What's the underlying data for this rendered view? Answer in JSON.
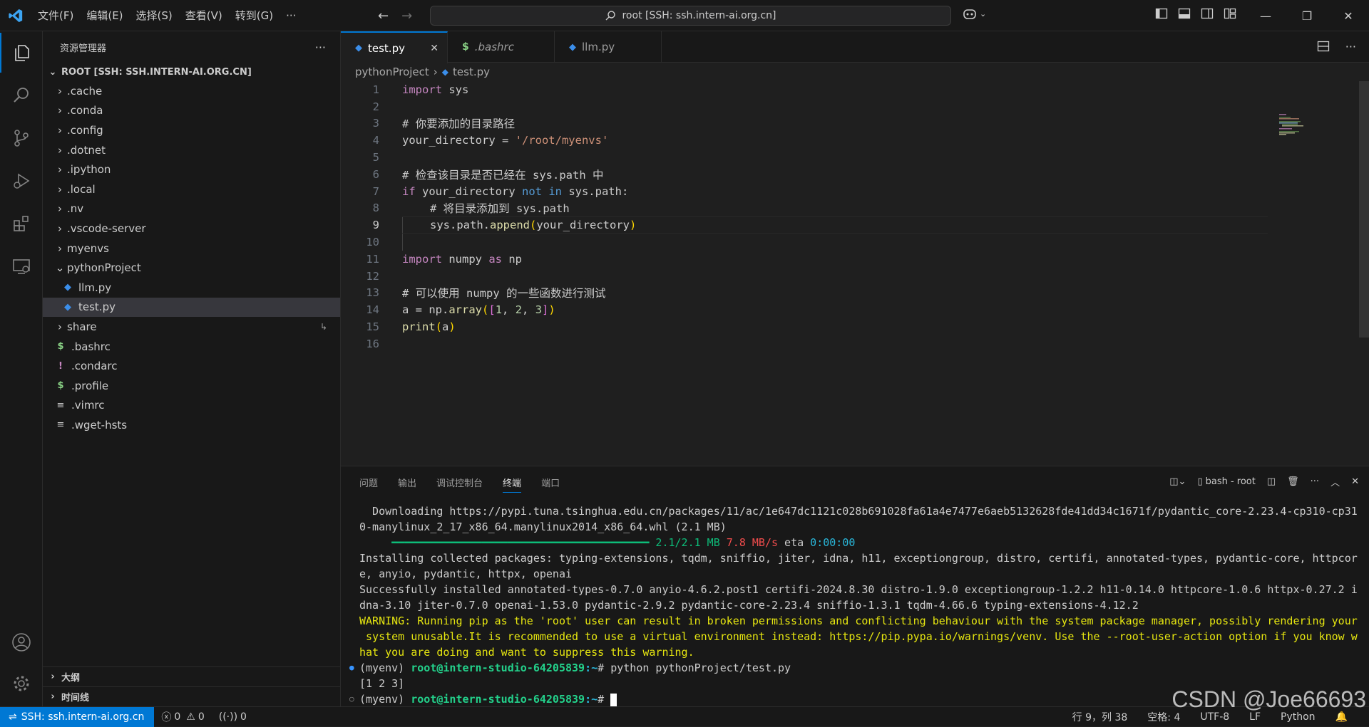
{
  "titlebar": {
    "menu": [
      "文件(F)",
      "编辑(E)",
      "选择(S)",
      "查看(V)",
      "转到(G)",
      "···"
    ],
    "search_text": "root [SSH: ssh.intern-ai.org.cn]"
  },
  "sidebar": {
    "title": "资源管理器",
    "root_label": "ROOT [SSH: SSH.INTERN-AI.ORG.CN]",
    "items": [
      {
        "label": ".cache",
        "type": "folder"
      },
      {
        "label": ".conda",
        "type": "folder"
      },
      {
        "label": ".config",
        "type": "folder"
      },
      {
        "label": ".dotnet",
        "type": "folder"
      },
      {
        "label": ".ipython",
        "type": "folder"
      },
      {
        "label": ".local",
        "type": "folder"
      },
      {
        "label": ".nv",
        "type": "folder"
      },
      {
        "label": ".vscode-server",
        "type": "folder"
      },
      {
        "label": "myenvs",
        "type": "folder"
      },
      {
        "label": "pythonProject",
        "type": "folder-open"
      },
      {
        "label": "llm.py",
        "type": "python"
      },
      {
        "label": "test.py",
        "type": "python"
      },
      {
        "label": "share",
        "type": "folder"
      },
      {
        "label": ".bashrc",
        "type": "shell"
      },
      {
        "label": ".condarc",
        "type": "bang"
      },
      {
        "label": ".profile",
        "type": "shell"
      },
      {
        "label": ".vimrc",
        "type": "text"
      },
      {
        "label": ".wget-hsts",
        "type": "text"
      }
    ],
    "outline_label": "大纲",
    "timeline_label": "时间线"
  },
  "tabs": [
    {
      "label": "test.py",
      "active": true
    },
    {
      "label": ".bashrc",
      "active": false
    },
    {
      "label": "llm.py",
      "active": false
    }
  ],
  "breadcrumb": {
    "folder": "pythonProject",
    "file": "test.py"
  },
  "code_lines": [
    "1",
    "2",
    "3",
    "4",
    "5",
    "6",
    "7",
    "8",
    "9",
    "10",
    "11",
    "12",
    "13",
    "14",
    "15",
    "16"
  ],
  "code": {
    "l1_kw": "import",
    "l1_rest": " sys",
    "l3": "# 你要添加的目录路径",
    "l4_a": "your_directory = ",
    "l4_str": "'/root/myenvs'",
    "l6": "# 检查该目录是否已经在 sys.path 中",
    "l7_if": "if",
    "l7_a": " your_directory ",
    "l7_not": "not",
    "l7_in": " in",
    "l7_b": " sys.path:",
    "l8": "# 将目录添加到 sys.path",
    "l9_a": "sys.path.",
    "l9_fn": "append",
    "l9_p1": "(",
    "l9_b": "your_directory",
    "l9_p2": ")",
    "l11_kw": "import",
    "l11_a": " numpy ",
    "l11_as": "as",
    "l11_b": " np",
    "l13": "# 可以使用 numpy 的一些函数进行测试",
    "l14_a": "a = np.",
    "l14_fn": "array",
    "l14_p1": "(",
    "l14_b1": "[",
    "l14_n1": "1",
    "l14_c1": ", ",
    "l14_n2": "2",
    "l14_c2": ", ",
    "l14_n3": "3",
    "l14_b2": "]",
    "l14_p2": ")",
    "l15_fn": "print",
    "l15_p1": "(",
    "l15_a": "a",
    "l15_p2": ")"
  },
  "panel": {
    "tabs": [
      "问题",
      "输出",
      "调试控制台",
      "终端",
      "端口"
    ],
    "active_tab": "终端",
    "terminal_name": "bash - root"
  },
  "terminal": {
    "l1": "  Downloading https://pypi.tuna.tsinghua.edu.cn/packages/11/ac/1e647dc1121c028b691028fa61a4e7477e6aeb5132628fde41dd34c1671f/pydantic_core-2.23.4-cp310-cp31",
    "l2": "0-manylinux_2_17_x86_64.manylinux2014_x86_64.whl (2.1 MB)",
    "l3_bar": "     ━━━━━━━━━━━━━━━━━━━━━━━━━━━━━━━━━━━━━━━━ ",
    "l3_size": "2.1/2.1 MB",
    "l3_speed": " 7.8 MB/s",
    "l3_eta": " eta ",
    "l3_time": "0:00:00",
    "l4": "Installing collected packages: typing-extensions, tqdm, sniffio, jiter, idna, h11, exceptiongroup, distro, certifi, annotated-types, pydantic-core, httpcor",
    "l5": "e, anyio, pydantic, httpx, openai",
    "l6": "Successfully installed annotated-types-0.7.0 anyio-4.6.2.post1 certifi-2024.8.30 distro-1.9.0 exceptiongroup-1.2.2 h11-0.14.0 httpcore-1.0.6 httpx-0.27.2 i",
    "l7": "dna-3.10 jiter-0.7.0 openai-1.53.0 pydantic-2.9.2 pydantic-core-2.23.4 sniffio-1.3.1 tqdm-4.66.6 typing-extensions-4.12.2",
    "l8": "WARNING: Running pip as the 'root' user can result in broken permissions and conflicting behaviour with the system package manager, possibly rendering your",
    "l9": " system unusable.It is recommended to use a virtual environment instead: https://pip.pypa.io/warnings/venv. Use the --root-user-action option if you know w",
    "l10": "hat you are doing and want to suppress this warning.",
    "prompt_env": "(myenv) ",
    "prompt_user": "root@intern-studio-64205839",
    "prompt_path": ":~",
    "prompt_sym": "# ",
    "cmd": "python pythonProject/test.py",
    "output": "[1 2 3]"
  },
  "statusbar": {
    "remote": "SSH: ssh.intern-ai.org.cn",
    "errors": "0",
    "warnings": "0",
    "ports": "0",
    "position": "行 9，列 38",
    "spaces": "空格: 4",
    "encoding": "UTF-8",
    "eol": "LF",
    "language": "Python"
  },
  "watermark": "CSDN @Joe66693",
  "colors": {
    "accent": "#0078d4",
    "background": "#1f1f1f",
    "sidebar": "#181818"
  }
}
